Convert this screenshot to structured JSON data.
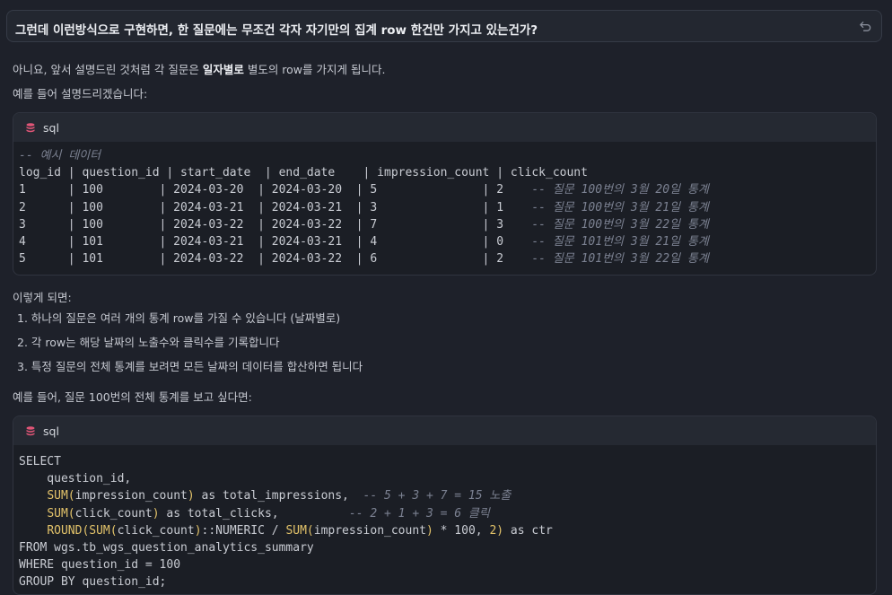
{
  "question": {
    "text": "그런데 이런방식으로 구현하면, 한 질문에는 무조건 각자 자기만의 집계 row 한건만 가지고 있는건가?"
  },
  "answer": {
    "intro_prefix": "아니요, 앞서 설명드린 것처럼 각 질문은 ",
    "intro_bold": "일자별로",
    "intro_suffix": " 별도의 row를 가지게 됩니다.",
    "example_lead": "예를 들어 설명드리겠습니다:",
    "then_lead": "이렇게 되면:",
    "steps": [
      "1. 하나의 질문은 여러 개의 통계 row를 가질 수 있습니다 (날짜별로)",
      "2. 각 row는 해당 날짜의 노출수와 클릭수를 기록합니다",
      "3. 특정 질문의 전체 통계를 보려면 모든 날짜의 데이터를 합산하면 됩니다"
    ],
    "total_lead": "예를 들어, 질문 100번의 전체 통계를 보고 싶다면:"
  },
  "code_blocks": [
    {
      "language": "sql",
      "lines": [
        {
          "comment": "-- 예시 데이터"
        },
        {
          "text": "log_id | question_id | start_date  | end_date    | impression_count | click_count"
        },
        {
          "text": "1      | 100        | 2024-03-20  | 2024-03-20  | 5               | 2    ",
          "comment": "-- 질문 100번의 3월 20일 통계"
        },
        {
          "text": "2      | 100        | 2024-03-21  | 2024-03-21  | 3               | 1    ",
          "comment": "-- 질문 100번의 3월 21일 통계"
        },
        {
          "text": "3      | 100        | 2024-03-22  | 2024-03-22  | 7               | 3    ",
          "comment": "-- 질문 100번의 3월 22일 통계"
        },
        {
          "text": "4      | 101        | 2024-03-21  | 2024-03-21  | 4               | 0    ",
          "comment": "-- 질문 101번의 3월 21일 통계"
        },
        {
          "text": "5      | 101        | 2024-03-22  | 2024-03-22  | 6               | 2    ",
          "comment": "-- 질문 101번의 3월 22일 통계"
        }
      ]
    },
    {
      "language": "sql",
      "lines": [
        {
          "tokens": [
            {
              "t": "kw",
              "v": "SELECT"
            }
          ]
        },
        {
          "tokens": [
            {
              "t": "tx",
              "v": "    question_id,"
            }
          ]
        },
        {
          "tokens": [
            {
              "t": "tx",
              "v": "    "
            },
            {
              "t": "fn",
              "v": "SUM"
            },
            {
              "t": "fn",
              "v": "("
            },
            {
              "t": "tx",
              "v": "impression_count"
            },
            {
              "t": "fn",
              "v": ")"
            },
            {
              "t": "tx",
              "v": " as total_impressions,  "
            },
            {
              "t": "cm",
              "v": "-- 5 + 3 + 7 = 15 노출"
            }
          ]
        },
        {
          "tokens": [
            {
              "t": "tx",
              "v": "    "
            },
            {
              "t": "fn",
              "v": "SUM"
            },
            {
              "t": "fn",
              "v": "("
            },
            {
              "t": "tx",
              "v": "click_count"
            },
            {
              "t": "fn",
              "v": ")"
            },
            {
              "t": "tx",
              "v": " as total_clicks,          "
            },
            {
              "t": "cm",
              "v": "-- 2 + 1 + 3 = 6 클릭"
            }
          ]
        },
        {
          "tokens": [
            {
              "t": "tx",
              "v": "    "
            },
            {
              "t": "fn",
              "v": "ROUND"
            },
            {
              "t": "fn",
              "v": "("
            },
            {
              "t": "fn",
              "v": "SUM"
            },
            {
              "t": "fn",
              "v": "("
            },
            {
              "t": "tx",
              "v": "click_count"
            },
            {
              "t": "fn",
              "v": ")"
            },
            {
              "t": "tx",
              "v": "::NUMERIC / "
            },
            {
              "t": "fn",
              "v": "SUM"
            },
            {
              "t": "fn",
              "v": "("
            },
            {
              "t": "tx",
              "v": "impression_count"
            },
            {
              "t": "fn",
              "v": ")"
            },
            {
              "t": "tx",
              "v": " * 100, "
            },
            {
              "t": "num",
              "v": "2"
            },
            {
              "t": "fn",
              "v": ")"
            },
            {
              "t": "tx",
              "v": " as ctr"
            }
          ]
        },
        {
          "tokens": [
            {
              "t": "kw",
              "v": "FROM"
            },
            {
              "t": "tx",
              "v": " wgs.tb_wgs_question_analytics_summary"
            }
          ]
        },
        {
          "tokens": [
            {
              "t": "kw",
              "v": "WHERE"
            },
            {
              "t": "tx",
              "v": " question_id = 100"
            }
          ]
        },
        {
          "tokens": [
            {
              "t": "kw",
              "v": "GROUP BY"
            },
            {
              "t": "tx",
              "v": " question_id;"
            }
          ]
        }
      ]
    }
  ],
  "colors": {
    "background": "#1e212a",
    "code_header": "#252932",
    "code_body": "#1b1e25",
    "function_highlight": "#e3c36a",
    "comment": "#7b8191",
    "db_icon": "#e05577"
  },
  "icons": {
    "undo": "undo-arrow-icon",
    "language": "database-icon"
  }
}
